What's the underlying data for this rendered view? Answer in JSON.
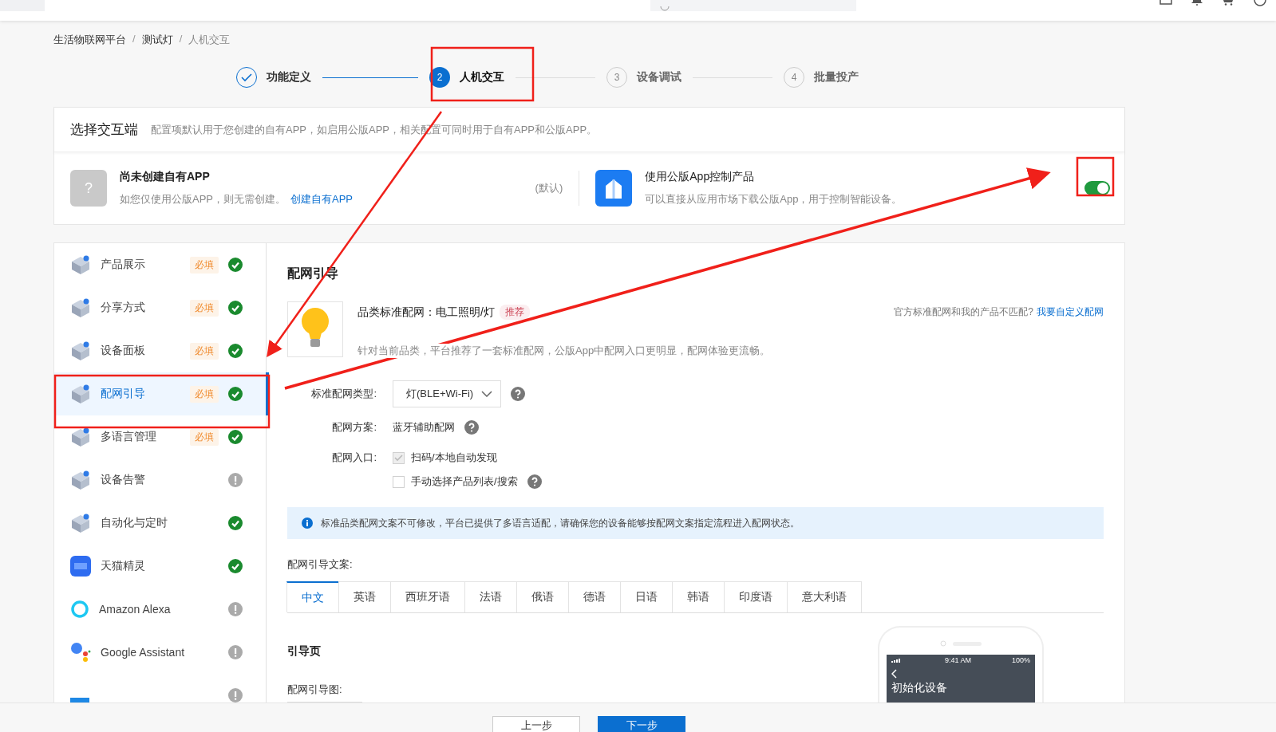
{
  "breadcrumb": [
    {
      "label": "生活物联网平台",
      "separator": "/"
    },
    {
      "label": "测试灯",
      "separator": "/"
    },
    {
      "label": "人机交互"
    }
  ],
  "steps": [
    {
      "label": "功能定义",
      "done": true,
      "active": false
    },
    {
      "number": "2",
      "label": "人机交互",
      "done": false,
      "active": true
    },
    {
      "number": "3",
      "label": "设备调试",
      "done": false,
      "active": false
    },
    {
      "number": "4",
      "label": "批量投产",
      "done": false,
      "active": false
    }
  ],
  "interaction": {
    "title": "选择交互端",
    "description": "配置项默认用于您创建的自有APP，如启用公版APP，相关配置可同时用于自有APP和公版APP。",
    "own_app": {
      "placeholder_icon": "?",
      "title": "尚未创建自有APP",
      "note": "如您仅使用公版APP，则无需创建。",
      "link": "创建自有APP",
      "default_tag": "(默认)"
    },
    "public_app": {
      "title": "使用公版App控制产品",
      "note": "可以直接从应用市场下载公版App，用于控制智能设备。",
      "on": true
    }
  },
  "sidebar": {
    "items": [
      {
        "label": "产品展示",
        "badge": "必填",
        "complete": true,
        "selected": false
      },
      {
        "label": "分享方式",
        "badge": "必填",
        "complete": true,
        "selected": false
      },
      {
        "label": "设备面板",
        "badge": "必填",
        "complete": true,
        "selected": false
      },
      {
        "label": "配网引导",
        "badge": "必填",
        "complete": true,
        "selected": true
      },
      {
        "label": "多语言管理",
        "badge": "必填",
        "complete": true,
        "selected": false
      },
      {
        "label": "设备告警",
        "complete": false,
        "selected": false
      },
      {
        "label": "自动化与定时",
        "complete": true,
        "selected": false
      },
      {
        "label": "天猫精灵",
        "complete": true,
        "selected": false
      },
      {
        "label": "Amazon Alexa",
        "complete": false,
        "selected": false
      },
      {
        "label": "Google Assistant",
        "complete": false,
        "selected": false
      },
      {
        "complete": false,
        "selected": false
      }
    ]
  },
  "content": {
    "title": "配网引导",
    "standard": {
      "label": "品类标准配网：电工照明/灯",
      "tag": "推荐",
      "description": "针对当前品类，平台推荐了一套标准配网，公版App中配网入口更明显，配网体验更流畅。",
      "mismatch": "官方标准配网和我的产品不匹配?",
      "custom_link": "我要自定义配网"
    },
    "form": {
      "type_label": "标准配网类型:",
      "type_value": "灯(BLE+Wi-Fi)",
      "scheme_label": "配网方案:",
      "scheme_value": "蓝牙辅助配网",
      "entry_label": "配网入口:",
      "entries": [
        {
          "label": "扫码/本地自动发现",
          "checked": true,
          "disabled": true,
          "help": false
        },
        {
          "label": "手动选择产品列表/搜索",
          "checked": false,
          "disabled": false,
          "help": true
        }
      ]
    },
    "notice": "标准品类配网文案不可修改，平台已提供了多语言适配，请确保您的设备能够按配网文案指定流程进入配网状态。",
    "copy_label": "配网引导文案:",
    "languages": [
      {
        "label": "中文",
        "selected": true
      },
      {
        "label": "英语",
        "selected": false
      },
      {
        "label": "西班牙语",
        "selected": false
      },
      {
        "label": "法语",
        "selected": false
      },
      {
        "label": "俄语",
        "selected": false
      },
      {
        "label": "德语",
        "selected": false
      },
      {
        "label": "日语",
        "selected": false
      },
      {
        "label": "韩语",
        "selected": false
      },
      {
        "label": "印度语",
        "selected": false
      },
      {
        "label": "意大利语",
        "selected": false
      }
    ],
    "guide_title": "引导页",
    "guide_image_label": "配网引导图:",
    "phone": {
      "time": "9:41 AM",
      "battery": "100%",
      "screen_title": "初始化设备"
    }
  },
  "footer": {
    "buttons": [
      {
        "label": "上一步",
        "kind": "secondary"
      },
      {
        "label": "下一步",
        "kind": "primary"
      }
    ]
  }
}
